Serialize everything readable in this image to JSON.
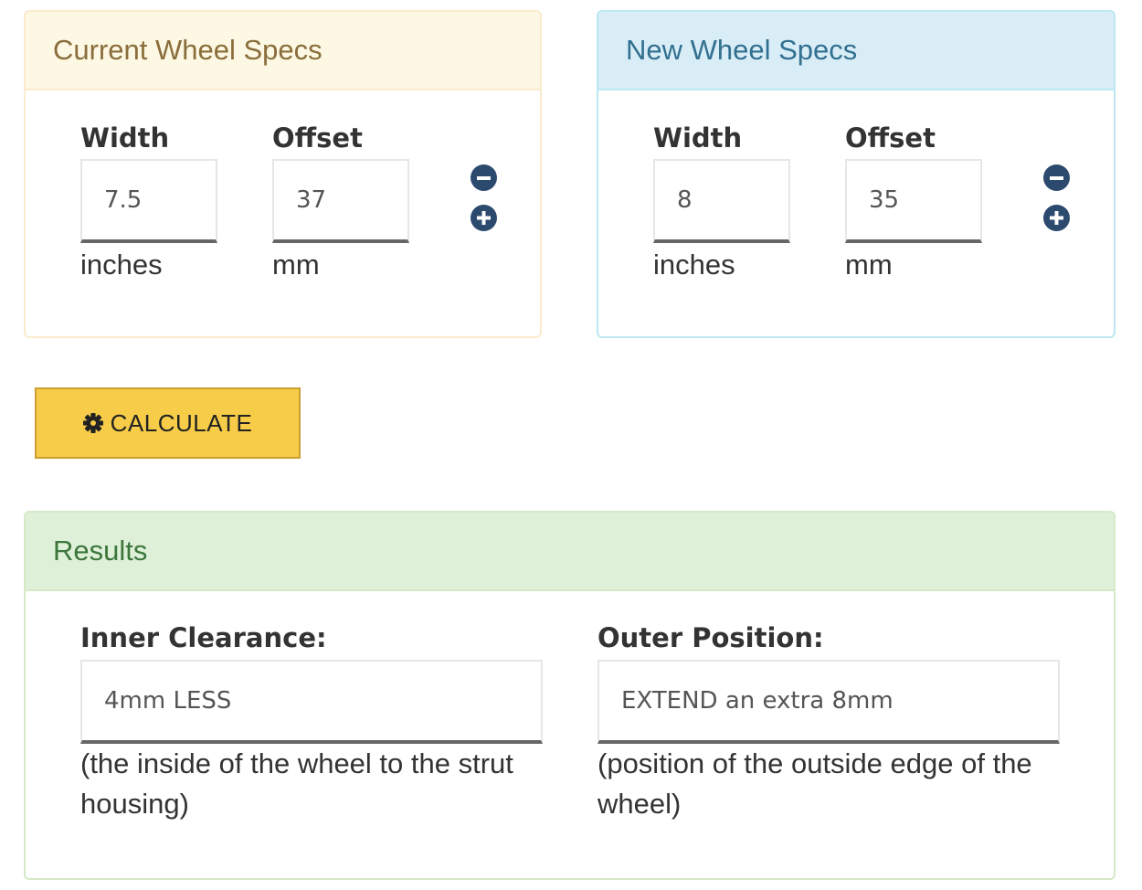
{
  "current": {
    "title": "Current Wheel Specs",
    "width_label": "Width",
    "width_value": "7.5",
    "width_unit": "inches",
    "offset_label": "Offset",
    "offset_value": "37",
    "offset_unit": "mm"
  },
  "new": {
    "title": "New Wheel Specs",
    "width_label": "Width",
    "width_value": "8",
    "width_unit": "inches",
    "offset_label": "Offset",
    "offset_value": "35",
    "offset_unit": "mm"
  },
  "calculate": {
    "label": "CALCULATE",
    "icon": "gear-icon"
  },
  "results": {
    "title": "Results",
    "inner_label": "Inner Clearance:",
    "inner_value": "4mm LESS",
    "inner_note": "(the inside of the wheel to the strut housing)",
    "outer_label": "Outer Position:",
    "outer_value": "EXTEND an extra 8mm",
    "outer_note": "(position of the outside edge of the wheel)"
  },
  "colors": {
    "warning_heading_bg": "#fcf8e3",
    "info_heading_bg": "#d9edf7",
    "success_heading_bg": "#dff0d8",
    "button_bg": "#f6cc48",
    "stepper_icon": "#2c4a6e"
  }
}
